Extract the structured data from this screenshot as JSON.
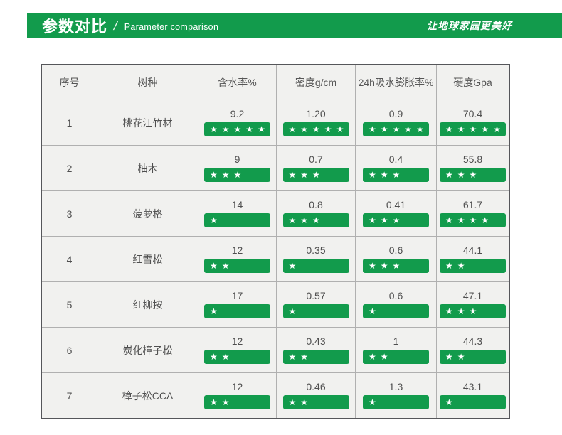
{
  "colors": {
    "brand_green": "#129b4c",
    "cell_bg": "#f1f1ef",
    "grid_line": "#b0b0b0",
    "outer_border": "#55565a",
    "text_color": "#4f4f4f"
  },
  "banner": {
    "title": "参数对比",
    "separator": "/",
    "subtitle": "Parameter comparison",
    "slogan": "让地球家园更美好"
  },
  "chart_data": {
    "type": "table",
    "title": "参数对比 / Parameter comparison",
    "columns": [
      "序号",
      "树种",
      "含水率%",
      "密度g/cm",
      "24h吸水膨胀率%",
      "硬度Gpa"
    ],
    "star_icon": "★",
    "max_stars": 5,
    "rows": [
      {
        "index": "1",
        "species": "桃花江竹材",
        "metrics": [
          {
            "value": "9.2",
            "stars": 5
          },
          {
            "value": "1.20",
            "stars": 5
          },
          {
            "value": "0.9",
            "stars": 5
          },
          {
            "value": "70.4",
            "stars": 5
          }
        ]
      },
      {
        "index": "2",
        "species": "柚木",
        "metrics": [
          {
            "value": "9",
            "stars": 3
          },
          {
            "value": "0.7",
            "stars": 3
          },
          {
            "value": "0.4",
            "stars": 3
          },
          {
            "value": "55.8",
            "stars": 3
          }
        ]
      },
      {
        "index": "3",
        "species": "菠萝格",
        "metrics": [
          {
            "value": "14",
            "stars": 1
          },
          {
            "value": "0.8",
            "stars": 3
          },
          {
            "value": "0.41",
            "stars": 3
          },
          {
            "value": "61.7",
            "stars": 4
          }
        ]
      },
      {
        "index": "4",
        "species": "红雪松",
        "metrics": [
          {
            "value": "12",
            "stars": 2
          },
          {
            "value": "0.35",
            "stars": 1
          },
          {
            "value": "0.6",
            "stars": 3
          },
          {
            "value": "44.1",
            "stars": 2
          }
        ]
      },
      {
        "index": "5",
        "species": "红柳按",
        "metrics": [
          {
            "value": "17",
            "stars": 1
          },
          {
            "value": "0.57",
            "stars": 1
          },
          {
            "value": "0.6",
            "stars": 1
          },
          {
            "value": "47.1",
            "stars": 3
          }
        ]
      },
      {
        "index": "6",
        "species": "炭化樟子松",
        "metrics": [
          {
            "value": "12",
            "stars": 2
          },
          {
            "value": "0.43",
            "stars": 2
          },
          {
            "value": "1",
            "stars": 2
          },
          {
            "value": "44.3",
            "stars": 2
          }
        ]
      },
      {
        "index": "7",
        "species": "樟子松CCA",
        "metrics": [
          {
            "value": "12",
            "stars": 2
          },
          {
            "value": "0.46",
            "stars": 2
          },
          {
            "value": "1.3",
            "stars": 1
          },
          {
            "value": "43.1",
            "stars": 1
          }
        ]
      }
    ]
  }
}
